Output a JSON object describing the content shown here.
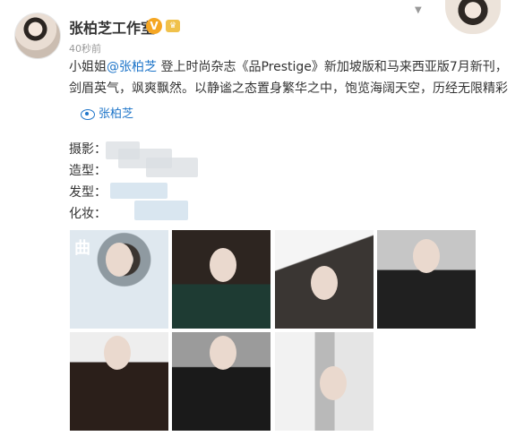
{
  "post": {
    "username": "张柏芝工作室",
    "time": "40秒前",
    "text_prefix": "小姐姐",
    "mention": "@张柏芝",
    "text_rest": " 登上时尚杂志《品Prestige》新加坡版和马来西亚版7月新刊，剑眉英气，飒爽飘然。以静谧之态置身繁华之中，饱览海阔天空，历经无限精彩",
    "tag": "张柏芝"
  },
  "credits": [
    {
      "label": "摄影："
    },
    {
      "label": "造型："
    },
    {
      "label": "发型："
    },
    {
      "label": "化妆："
    }
  ],
  "photos": {
    "mag_logo": "曲"
  }
}
